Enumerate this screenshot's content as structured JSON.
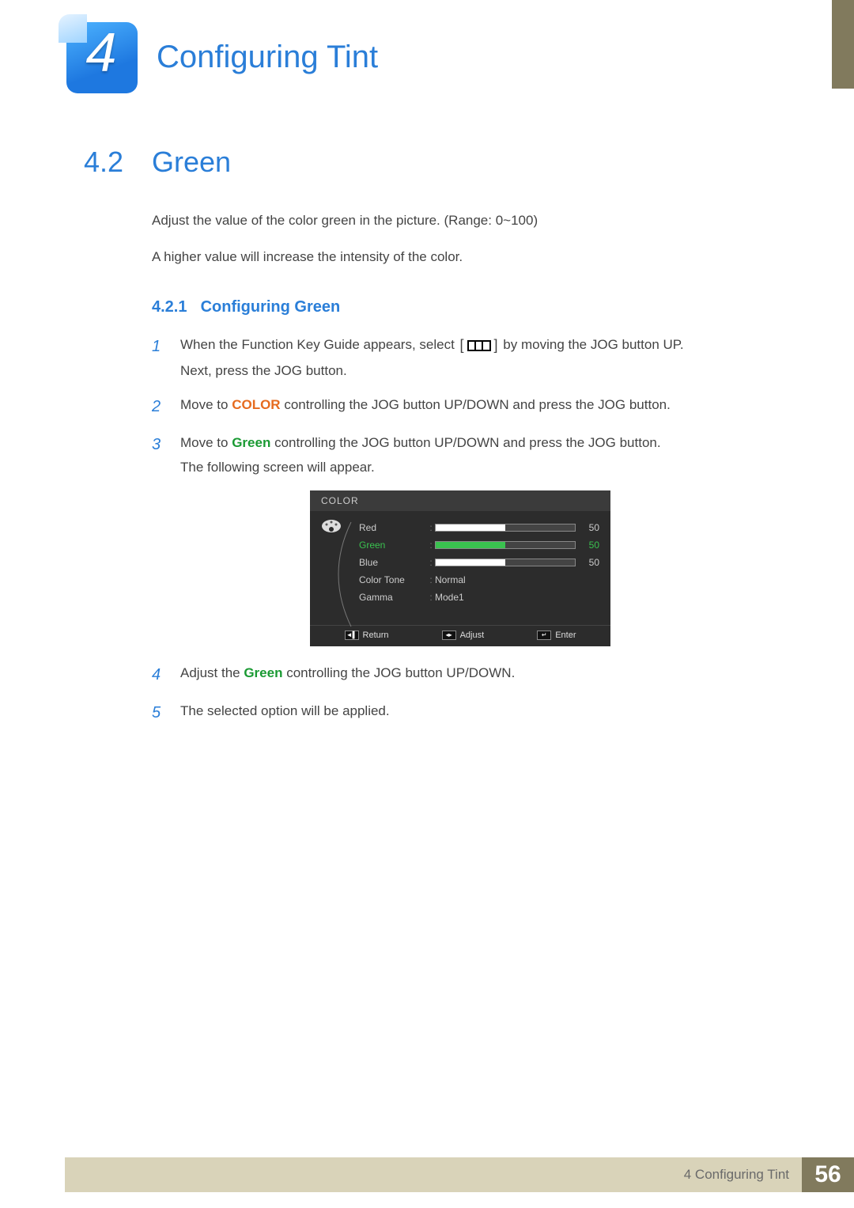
{
  "chapter": {
    "number": "4",
    "title": "Configuring Tint"
  },
  "section": {
    "number": "4.2",
    "title": "Green"
  },
  "intro": {
    "p1": "Adjust the value of the color green in the picture. (Range: 0~100)",
    "p2": "A higher value will increase the intensity of the color."
  },
  "subsection": {
    "number": "4.2.1",
    "title": "Configuring Green"
  },
  "steps": {
    "s1a": "When the Function Key Guide appears, select ",
    "s1b": " by moving the JOG button UP.",
    "s1c": "Next, press the JOG button.",
    "s2a": "Move to ",
    "s2_color": "COLOR",
    "s2b": " controlling the JOG button UP/DOWN and press the JOG button.",
    "s3a": "Move to ",
    "s3_green": "Green",
    "s3b": " controlling the JOG button UP/DOWN and press the JOG button.",
    "s3c": "The following screen will appear.",
    "s4a": "Adjust the ",
    "s4_green": "Green",
    "s4b": " controlling the JOG button UP/DOWN.",
    "s5": "The selected option will be applied."
  },
  "step_nums": {
    "n1": "1",
    "n2": "2",
    "n3": "3",
    "n4": "4",
    "n5": "5"
  },
  "osd": {
    "title": "COLOR",
    "rows": {
      "red": {
        "label": "Red",
        "val": "50",
        "pct": 50
      },
      "green": {
        "label": "Green",
        "val": "50",
        "pct": 50
      },
      "blue": {
        "label": "Blue",
        "val": "50",
        "pct": 50
      },
      "tone": {
        "label": "Color Tone",
        "text": "Normal"
      },
      "gamma": {
        "label": "Gamma",
        "text": "Mode1"
      }
    },
    "footer": {
      "return": "Return",
      "adjust": "Adjust",
      "enter": "Enter"
    }
  },
  "footer": {
    "chapter_ref": "4 Configuring Tint",
    "page": "56"
  }
}
